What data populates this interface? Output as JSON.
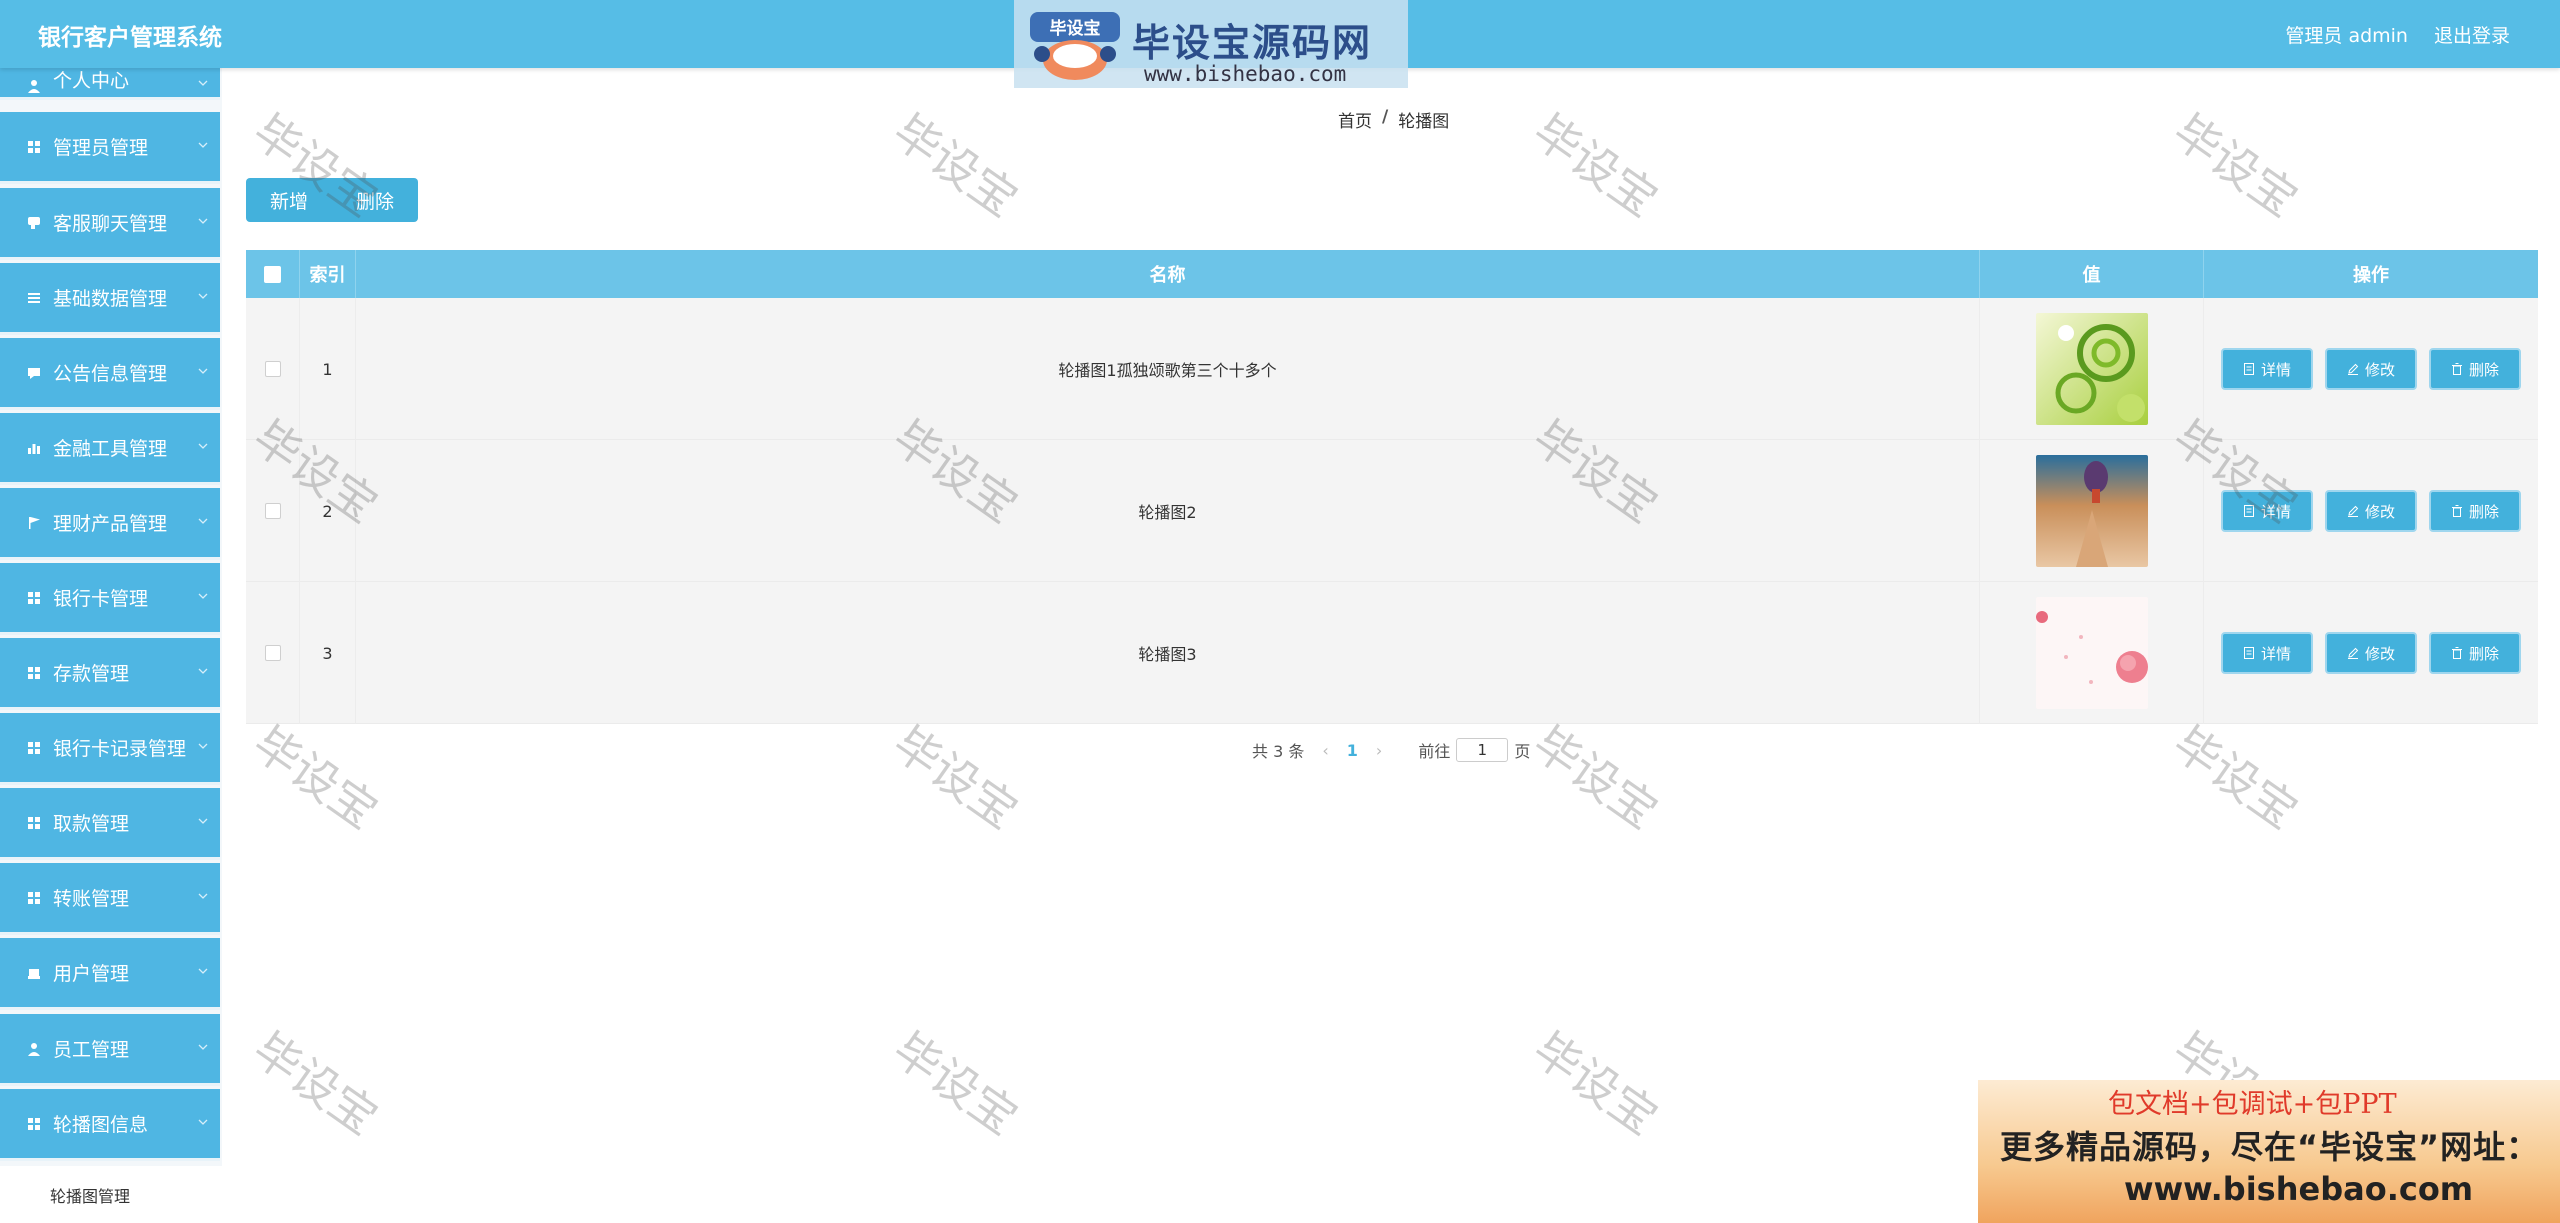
{
  "header": {
    "app_title": "银行客户管理系统",
    "admin_label": "管理员 admin",
    "logout_label": "退出登录"
  },
  "logo": {
    "badge_text": "毕设宝",
    "main_text": "毕设宝源码网",
    "url": "www.bishebao.com"
  },
  "sidebar": {
    "items": [
      {
        "label": "个人中心",
        "icon": "user-icon"
      },
      {
        "label": "管理员管理",
        "icon": "grid-icon"
      },
      {
        "label": "客服聊天管理",
        "icon": "chat-icon"
      },
      {
        "label": "基础数据管理",
        "icon": "list-icon"
      },
      {
        "label": "公告信息管理",
        "icon": "message-icon"
      },
      {
        "label": "金融工具管理",
        "icon": "bar-chart-icon"
      },
      {
        "label": "理财产品管理",
        "icon": "flag-icon"
      },
      {
        "label": "银行卡管理",
        "icon": "grid-icon"
      },
      {
        "label": "存款管理",
        "icon": "grid-icon"
      },
      {
        "label": "银行卡记录管理",
        "icon": "grid-icon"
      },
      {
        "label": "取款管理",
        "icon": "grid-icon"
      },
      {
        "label": "转账管理",
        "icon": "grid-icon"
      },
      {
        "label": "用户管理",
        "icon": "users-icon"
      },
      {
        "label": "员工管理",
        "icon": "user-icon"
      },
      {
        "label": "轮播图信息",
        "icon": "grid-icon"
      }
    ],
    "sub_item": "轮播图管理"
  },
  "breadcrumb": {
    "home": "首页",
    "separator": "/",
    "current": "轮播图"
  },
  "actions": {
    "add_label": "新增",
    "delete_label": "删除"
  },
  "table": {
    "headers": {
      "index": "索引",
      "name": "名称",
      "value": "值",
      "operation": "操作"
    },
    "rows": [
      {
        "index": "1",
        "name": "轮播图1孤独颂歌第三个十多个"
      },
      {
        "index": "2",
        "name": "轮播图2"
      },
      {
        "index": "3",
        "name": "轮播图3"
      }
    ],
    "op_labels": {
      "detail": "详情",
      "edit": "修改",
      "delete": "删除"
    }
  },
  "pagination": {
    "total_text": "共 3 条",
    "prev": "‹",
    "current_page": "1",
    "next": "›",
    "goto_label": "前往",
    "goto_value": "1",
    "page_suffix": "页"
  },
  "watermark": {
    "text": "毕设宝"
  },
  "ad_banner": {
    "line1": "包文档+包调试+包PPT",
    "line2": "更多精品源码，尽在“毕设宝”网址：",
    "line3": "www.bishebao.com"
  },
  "colors": {
    "primary": "#56bde6",
    "sidebar_item": "#4fb6e3",
    "button": "#43b1dc",
    "table_header": "#6cc4e8",
    "ad_accent": "#e03a2a"
  }
}
